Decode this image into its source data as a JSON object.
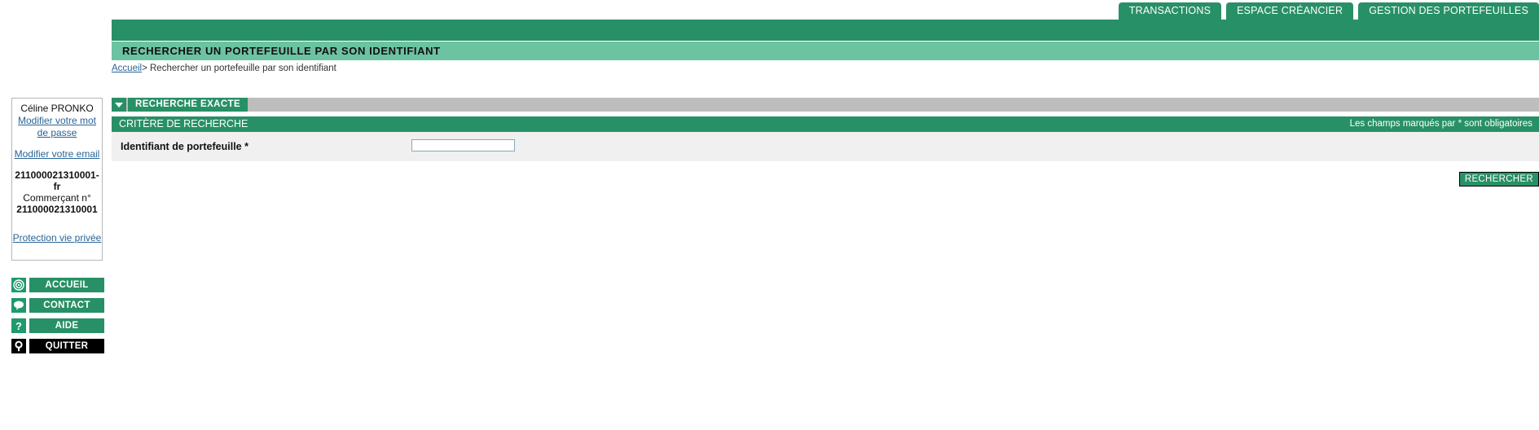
{
  "topnav": {
    "tabs": [
      {
        "label": "TRANSACTIONS",
        "name": "tab-transactions"
      },
      {
        "label": "ESPACE CRÉANCIER",
        "name": "tab-espace-creancier"
      },
      {
        "label": "GESTION DES PORTEFEUILLES",
        "name": "tab-gestion-des-portefeuilles"
      }
    ]
  },
  "header": {
    "page_title": "RECHERCHER UN PORTEFEUILLE PAR SON IDENTIFIANT"
  },
  "breadcrumb": {
    "home": "Accueil",
    "separator": ">",
    "current": "Rechercher un portefeuille par son identifiant"
  },
  "panel": {
    "tab_label": "RECHERCHE EXACTE",
    "collapse_icon": "triangle-down-icon",
    "section_title": "CRITÈRE DE RECHERCHE",
    "required_note": "Les champs marqués par * sont obligatoires",
    "field_label": "Identifiant de portefeuille *",
    "field_value": "",
    "field_placeholder": "",
    "submit_label": "RECHERCHER"
  },
  "sidebar": {
    "user_name": "Céline PRONKO",
    "link_password": "Modifier votre mot de passe",
    "link_email": "Modifier votre email",
    "merchant_id_top": "211000021310001-fr",
    "merchant_label": "Commerçant n°",
    "merchant_id_bottom": "211000021310001",
    "link_privacy": "Protection vie privée",
    "nav": [
      {
        "label": "ACCUEIL",
        "icon": "target-icon",
        "name": "nav-accueil"
      },
      {
        "label": "CONTACT",
        "icon": "speech-bubble-icon",
        "name": "nav-contact"
      },
      {
        "label": "AIDE",
        "icon": "question-mark-icon",
        "name": "nav-aide"
      },
      {
        "label": "QUITTER",
        "icon": "power-key-icon",
        "name": "nav-quitter"
      }
    ]
  },
  "colors": {
    "brand_green": "#289066",
    "title_green": "#6cc3a1",
    "gray_bar": "#bdbdbd",
    "row_gray": "#f0f0f0",
    "link_blue": "#2a6496"
  }
}
